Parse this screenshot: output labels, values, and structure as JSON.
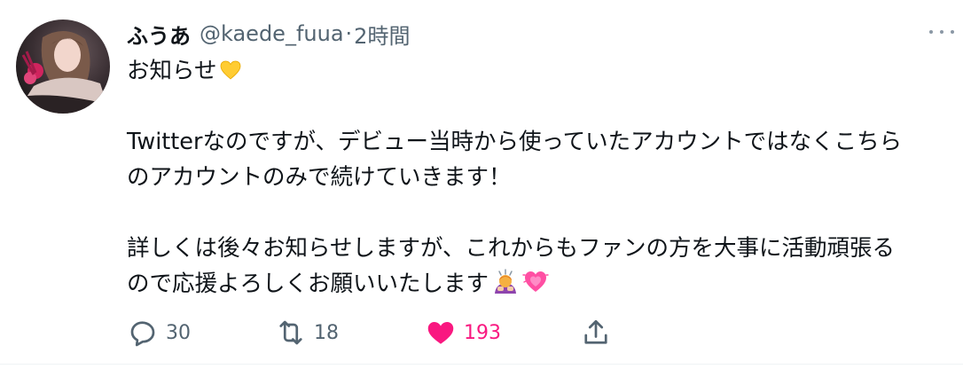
{
  "tweet": {
    "author": {
      "display_name": "ふうあ",
      "handle": "@kaede_fuua",
      "separator": "·",
      "time": "2時間"
    },
    "body": {
      "line1": "お知らせ",
      "line1_emoji": "yellow-heart",
      "line2": "Twitterなのですが、デビュー当時から使っていたアカウントではなくこちら",
      "line3": "のアカウントのみで続けていきます！",
      "line4": "詳しくは後々お知らせしますが、これからもファンの方を大事に活動頑張る",
      "line5": "ので応援よろしくお願いいたします",
      "line5_emojis": [
        "person-bowing",
        "growing-heart"
      ]
    },
    "actions": {
      "reply_count": "30",
      "retweet_count": "18",
      "like_count": "193",
      "liked": true
    },
    "colors": {
      "text": "#0f1419",
      "secondary": "#536471",
      "like": "#f91880"
    }
  }
}
